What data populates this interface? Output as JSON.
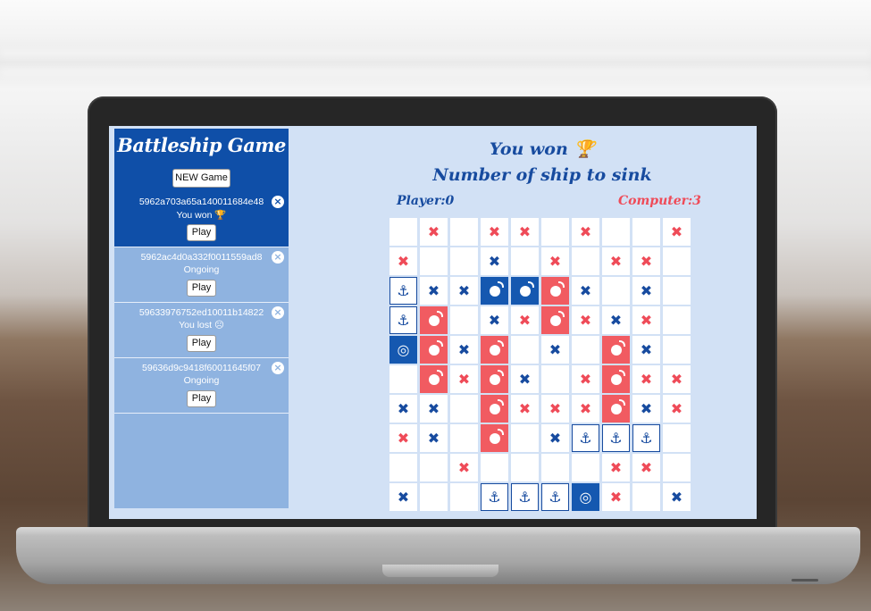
{
  "app": {
    "title": "Battleship Game",
    "new_game_label": "NEW Game"
  },
  "games": [
    {
      "id": "5962a703a65a140011684e48",
      "status": "You won 🏆",
      "play_label": "Play",
      "active": true
    },
    {
      "id": "5962ac4d0a332f0011559ad8",
      "status": "Ongoing",
      "play_label": "Play",
      "active": false
    },
    {
      "id": "59633976752ed10011b14822",
      "status": "You lost ☹",
      "play_label": "Play",
      "active": false
    },
    {
      "id": "59636d9c9418f60011645f07",
      "status": "Ongoing",
      "play_label": "Play",
      "active": false
    }
  ],
  "main": {
    "result": "You won 🏆",
    "subtitle": "Number of ship to sink",
    "player_label": "Player:0",
    "computer_label": "Computer:3"
  },
  "colors": {
    "sidebar_dark": "#0f4fa8",
    "sidebar_light": "#8fb3e0",
    "screen_bg": "#d2e1f5",
    "accent_red": "#ef4b58",
    "accent_blue": "#174b9f"
  },
  "board": [
    [
      "",
      "hx",
      "",
      "hx",
      "hx",
      "",
      "hx",
      "",
      "",
      "hx"
    ],
    [
      "hx",
      "",
      "",
      "mx",
      "",
      "hx",
      "",
      "hx",
      "hx",
      ""
    ],
    [
      "ship",
      "mx",
      "mx",
      "bombb",
      "bombb",
      "bomb",
      "mx",
      "",
      "mx",
      ""
    ],
    [
      "ship",
      "bomb",
      "",
      "mx",
      "hx",
      "bomb",
      "hx",
      "mx",
      "hx",
      ""
    ],
    [
      "target",
      "bomb",
      "mx",
      "bomb",
      "",
      "mx",
      "",
      "bomb",
      "mx",
      ""
    ],
    [
      "",
      "bomb",
      "hx",
      "bomb",
      "mx",
      "",
      "hx",
      "bomb",
      "hx",
      "hx"
    ],
    [
      "mx",
      "mx",
      "",
      "bomb",
      "hx",
      "hx",
      "hx",
      "bomb",
      "mx",
      "hx"
    ],
    [
      "hx",
      "mx",
      "",
      "bomb",
      "",
      "mx",
      "ship",
      "ship",
      "ship",
      ""
    ],
    [
      "",
      "",
      "hx",
      "",
      "",
      "",
      "",
      "hx",
      "hx",
      ""
    ],
    [
      "mx",
      "",
      "",
      "ship",
      "ship",
      "ship",
      "target",
      "hx",
      "",
      "mx"
    ]
  ]
}
